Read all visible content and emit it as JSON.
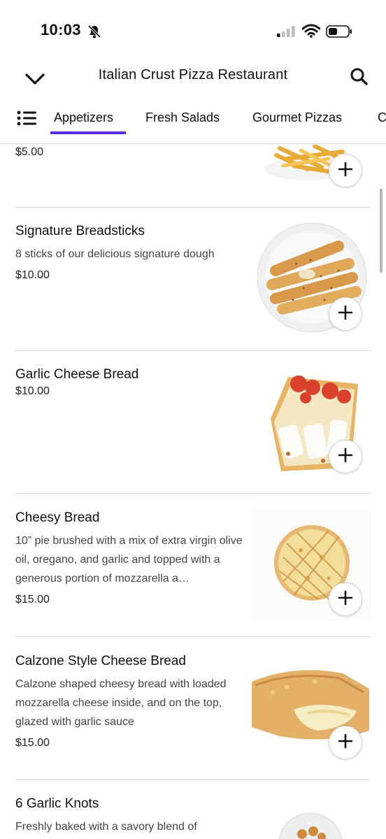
{
  "status_bar": {
    "time": "10:03"
  },
  "header": {
    "title": "Italian Crust Pizza Restaurant"
  },
  "tabs": [
    {
      "label": "Appetizers",
      "active": true
    },
    {
      "label": "Fresh Salads",
      "active": false
    },
    {
      "label": "Gourmet Pizzas",
      "active": false
    },
    {
      "label": "C",
      "active": false
    }
  ],
  "items": [
    {
      "name": "",
      "description": "",
      "price": "$5.00"
    },
    {
      "name": "Signature Breadsticks",
      "description": "8 sticks of our delicious signature dough",
      "price": "$10.00"
    },
    {
      "name": "Garlic Cheese Bread",
      "description": "",
      "price": "$10.00"
    },
    {
      "name": "Cheesy Bread",
      "description": "10” pie brushed with a mix of extra virgin olive oil, oregano, and garlic and topped with a generous portion of mozzarella a…",
      "price": "$15.00"
    },
    {
      "name": "Calzone Style Cheese Bread",
      "description": "Calzone shaped cheesy bread with loaded mozzarella cheese inside, and on the top, glazed with garlic sauce",
      "price": "$15.00"
    },
    {
      "name": "6 Garlic Knots",
      "description": "Freshly baked with a savory blend of",
      "price": ""
    }
  ],
  "icons": {
    "back": "chevron-down-icon",
    "search": "search-icon",
    "menu": "list-icon",
    "add": "plus-icon",
    "silent": "bell-slash-icon"
  },
  "colors": {
    "accent": "#5a2ee6",
    "divider": "#d6d6d6"
  }
}
